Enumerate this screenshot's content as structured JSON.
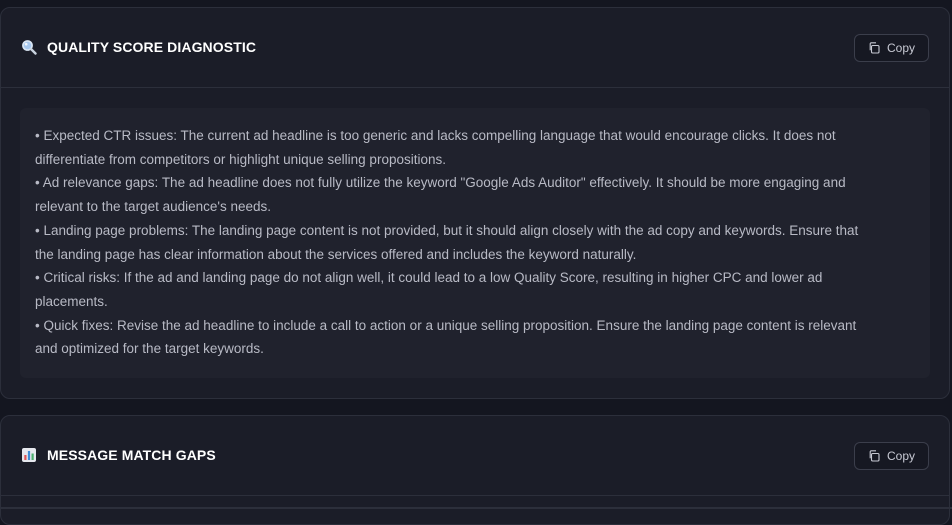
{
  "sections": [
    {
      "icon": "magnifier-icon",
      "title": "QUALITY SCORE DIAGNOSTIC",
      "copy_label": "Copy",
      "lines": [
        "• Expected CTR issues: The current ad headline is too generic and lacks compelling language that would encourage clicks. It does not",
        "differentiate from competitors or highlight unique selling propositions.",
        "• Ad relevance gaps: The ad headline does not fully utilize the keyword \"Google Ads Auditor\" effectively. It should be more engaging and",
        "relevant to the target audience's needs.",
        "• Landing page problems: The landing page content is not provided, but it should align closely with the ad copy and keywords. Ensure that",
        "the landing page has clear information about the services offered and includes the keyword naturally.",
        "• Critical risks: If the ad and landing page do not align well, it could lead to a low Quality Score, resulting in higher CPC and lower ad",
        "placements.",
        "• Quick fixes: Revise the ad headline to include a call to action or a unique selling proposition. Ensure the landing page content is relevant",
        "and optimized for the target keywords."
      ]
    },
    {
      "icon": "bar-chart-icon",
      "title": "MESSAGE MATCH GAPS",
      "copy_label": "Copy"
    }
  ],
  "colors": {
    "background": "#141620",
    "card": "#1b1d28",
    "content_box": "#20222d",
    "border": "#2c2f3b",
    "title": "#ffffff",
    "body_text": "#b8bac5"
  }
}
